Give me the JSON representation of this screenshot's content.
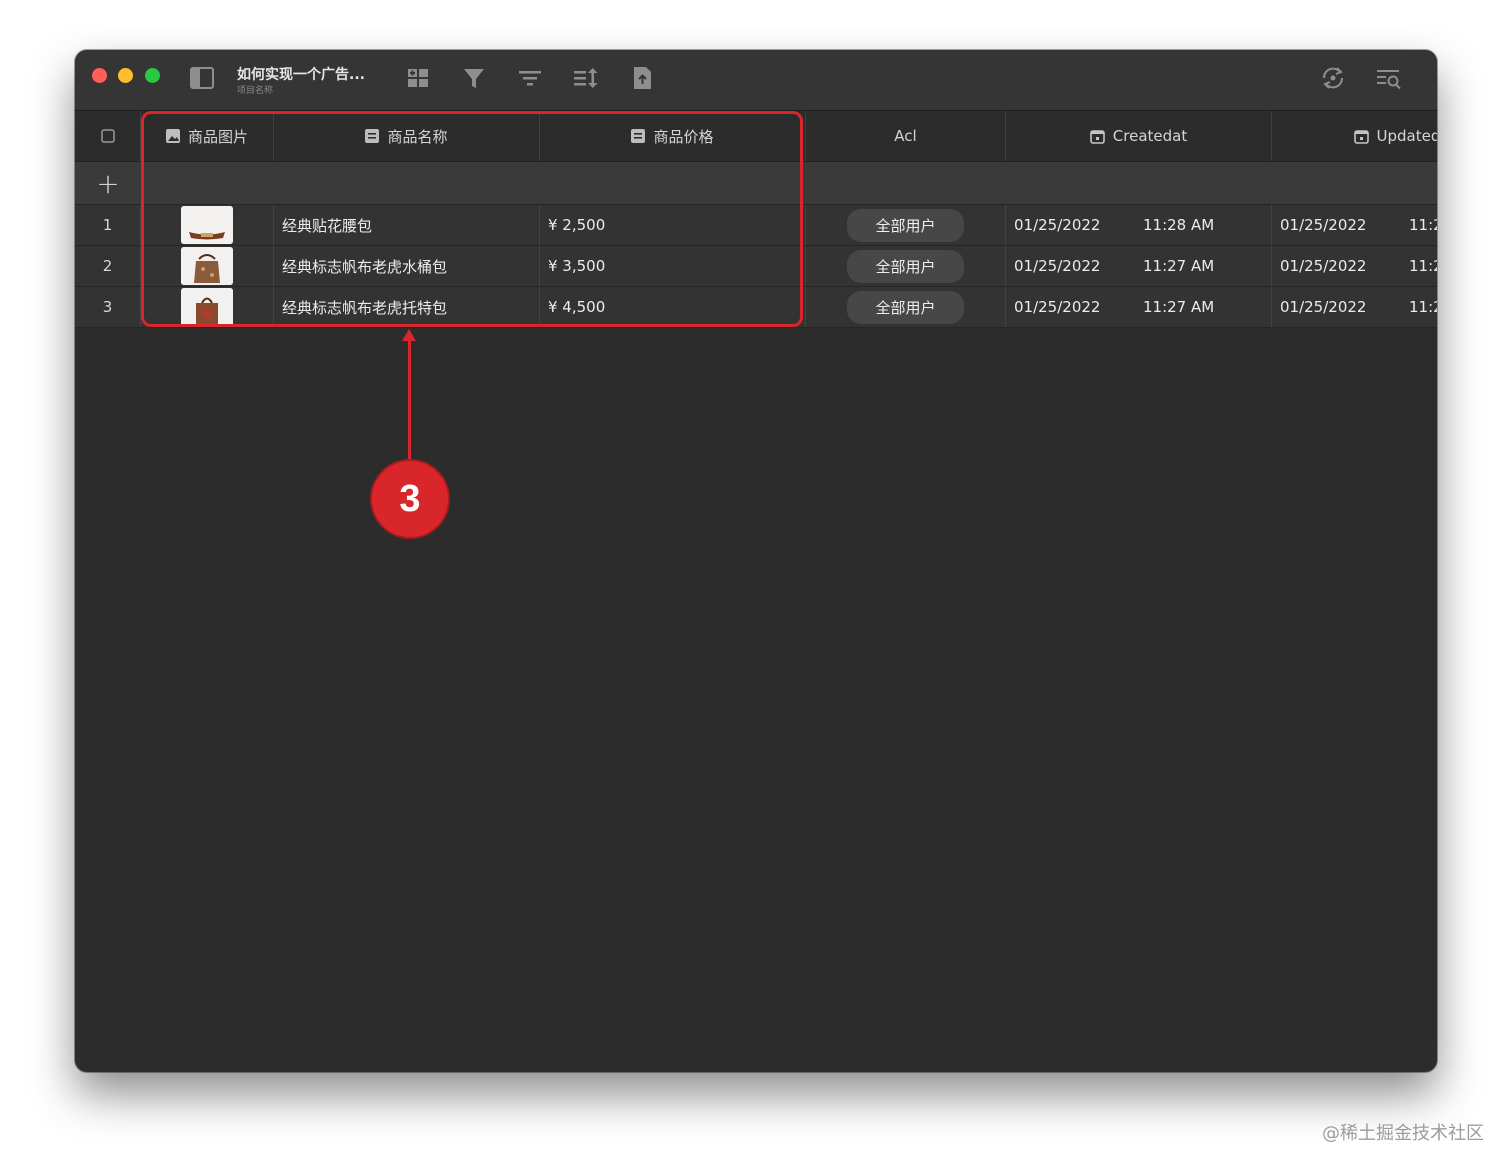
{
  "window": {
    "project_title": "如何实现一个广告...",
    "project_subtitle": "项目名称"
  },
  "toolbar_icons": [
    "sidebar-toggle-icon",
    "add-column-icon",
    "filter-icon",
    "group-icon",
    "sort-icon",
    "export-icon",
    "refresh-icon",
    "search-list-icon"
  ],
  "columns": [
    {
      "label": "商品图片",
      "icon": "image-icon"
    },
    {
      "label": "商品名称",
      "icon": "text-field-icon"
    },
    {
      "label": "商品价格",
      "icon": "text-field-icon"
    },
    {
      "label": "Acl",
      "icon": ""
    },
    {
      "label": "Createdat",
      "icon": "calendar-icon"
    },
    {
      "label": "Updatedat",
      "icon": "calendar-icon"
    }
  ],
  "add_row_symbol": "+",
  "rows": [
    {
      "num": "1",
      "name": "经典贴花腰包",
      "price": "¥ 2,500",
      "acl": "全部用户",
      "created_date": "01/25/2022",
      "created_time": "11:28 AM",
      "updated_date": "01/25/2022",
      "updated_time": "11:2"
    },
    {
      "num": "2",
      "name": "经典标志帆布老虎水桶包",
      "price": "¥ 3,500",
      "acl": "全部用户",
      "created_date": "01/25/2022",
      "created_time": "11:27 AM",
      "updated_date": "01/25/2022",
      "updated_time": "11:2"
    },
    {
      "num": "3",
      "name": "经典标志帆布老虎托特包",
      "price": "¥ 4,500",
      "acl": "全部用户",
      "created_date": "01/25/2022",
      "created_time": "11:27 AM",
      "updated_date": "01/25/2022",
      "updated_time": "11:2"
    }
  ],
  "annotation": {
    "badge": "3",
    "color": "#d9262b"
  },
  "watermark": "@稀土掘金技术社区"
}
